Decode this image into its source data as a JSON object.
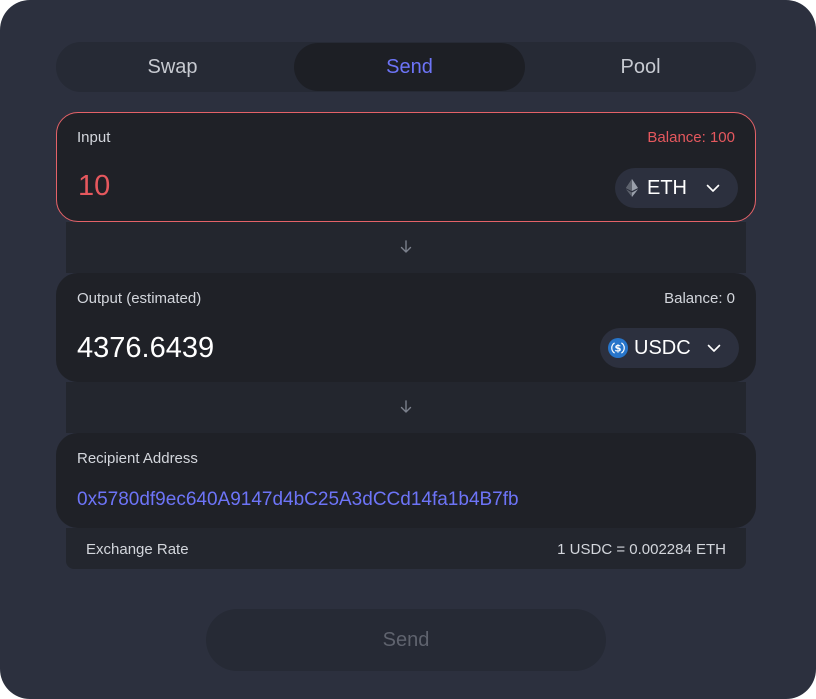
{
  "tabs": [
    {
      "label": "Swap",
      "active": false
    },
    {
      "label": "Send",
      "active": true
    },
    {
      "label": "Pool",
      "active": false
    }
  ],
  "input": {
    "label": "Input",
    "balance": "Balance: 100",
    "amount": "10",
    "token": "ETH",
    "token_icon": "eth-icon"
  },
  "output": {
    "label": "Output (estimated)",
    "balance": "Balance: 0",
    "amount": "4376.6439",
    "token": "USDC",
    "token_icon": "usdc-icon"
  },
  "recipient": {
    "label": "Recipient Address",
    "address": "0x5780df9ec640A9147d4bC25A3dCCd14fa1b4B7fb"
  },
  "exchange_rate": {
    "label": "Exchange Rate",
    "value": "1 USDC = 0.002284 ETH"
  },
  "send_button": {
    "label": "Send",
    "enabled": false
  },
  "colors": {
    "background": "#2c303e",
    "panel": "#1f2127",
    "accent": "#6d74f7",
    "error": "#e5585e",
    "usdc": "#2775ca"
  }
}
